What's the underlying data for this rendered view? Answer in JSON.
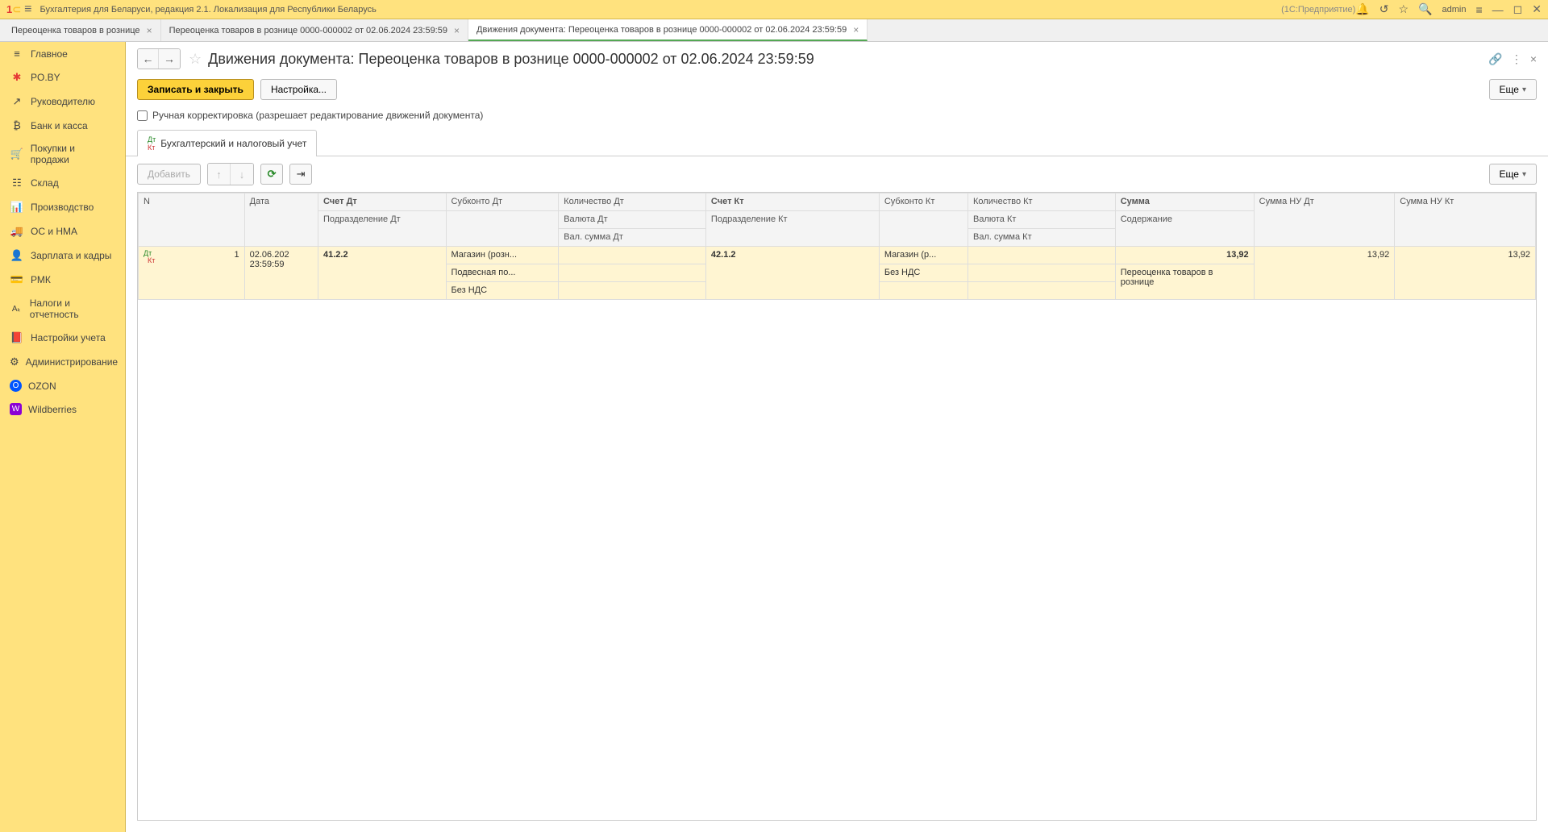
{
  "titlebar": {
    "app_title": "Бухгалтерия для Беларуси, редакция 2.1. Локализация для Республики Беларусь",
    "platform": "(1С:Предприятие)",
    "user": "admin"
  },
  "tabs": [
    {
      "label": "Переоценка товаров в рознице"
    },
    {
      "label": "Переоценка товаров в рознице 0000-000002 от 02.06.2024 23:59:59"
    },
    {
      "label": "Движения документа: Переоценка товаров в рознице 0000-000002 от 02.06.2024 23:59:59",
      "active": true
    }
  ],
  "sidebar": {
    "items": [
      {
        "label": "Главное",
        "icon": "≡"
      },
      {
        "label": "PO.BY",
        "icon": "✱",
        "color": "#e53935"
      },
      {
        "label": "Руководителю",
        "icon": "↗"
      },
      {
        "label": "Банк и касса",
        "icon": "₿"
      },
      {
        "label": "Покупки и продажи",
        "icon": "🛒"
      },
      {
        "label": "Склад",
        "icon": "☷"
      },
      {
        "label": "Производство",
        "icon": "⚙"
      },
      {
        "label": "ОС и НМА",
        "icon": "🚚"
      },
      {
        "label": "Зарплата и кадры",
        "icon": "👤"
      },
      {
        "label": "РМК",
        "icon": "💳"
      },
      {
        "label": "Налоги и отчетность",
        "icon": "Aₓ"
      },
      {
        "label": "Настройки учета",
        "icon": "📕"
      },
      {
        "label": "Администрирование",
        "icon": "⚙"
      },
      {
        "label": "OZON",
        "icon": "O",
        "bg": "#0055ff",
        "fg": "#fff"
      },
      {
        "label": "Wildberries",
        "icon": "W",
        "bg": "#8b00d4",
        "fg": "#fff"
      }
    ]
  },
  "page": {
    "title": "Движения документа: Переоценка товаров в рознице 0000-000002 от 02.06.2024 23:59:59",
    "btn_save_close": "Записать и закрыть",
    "btn_settings": "Настройка...",
    "btn_more": "Еще",
    "checkbox_label": "Ручная корректировка (разрешает редактирование движений документа)",
    "inner_tab": "Бухгалтерский и налоговый учет",
    "btn_add": "Добавить"
  },
  "table": {
    "headers": {
      "n": "N",
      "date": "Дата",
      "acc_dt": "Счет Дт",
      "sub_dt": "Субконто Дт",
      "qty_dt": "Количество Дт",
      "dept_dt": "Подразделение Дт",
      "cur_dt": "Валюта Дт",
      "curval_dt": "Вал. сумма Дт",
      "acc_kt": "Счет Кт",
      "sub_kt": "Субконто Кт",
      "qty_kt": "Количество Кт",
      "dept_kt": "Подразделение Кт",
      "cur_kt": "Валюта Кт",
      "curval_kt": "Вал. сумма Кт",
      "sum": "Сумма",
      "content": "Содержание",
      "nu_dt": "Сумма НУ Дт",
      "nu_kt": "Сумма НУ Кт"
    },
    "row": {
      "n": "1",
      "date_line1": "02.06.202",
      "date_line2": "23:59:59",
      "acc_dt": "41.2.2",
      "sub_dt_1": "Магазин (розн...",
      "sub_dt_2": "Подвесная по...",
      "sub_dt_3": "Без НДС",
      "acc_kt": "42.1.2",
      "sub_kt_1": "Магазин (р...",
      "sub_kt_2": "Без НДС",
      "sum": "13,92",
      "content": "Переоценка товаров в рознице",
      "nu_dt": "13,92",
      "nu_kt": "13,92"
    }
  }
}
